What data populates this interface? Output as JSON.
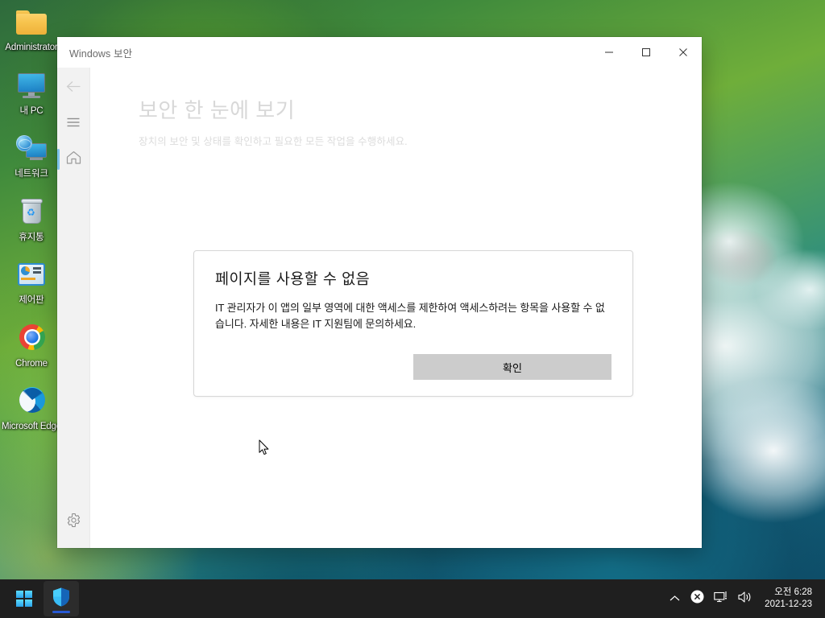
{
  "desktop": {
    "icons": [
      {
        "label": "Administrator",
        "icon": "folder-icon"
      },
      {
        "label": "내 PC",
        "icon": "computer-icon"
      },
      {
        "label": "네트워크",
        "icon": "network-icon"
      },
      {
        "label": "휴지통",
        "icon": "recycle-bin-icon"
      },
      {
        "label": "제어판",
        "icon": "control-panel-icon"
      },
      {
        "label": "Chrome",
        "icon": "chrome-icon"
      },
      {
        "label": "Microsoft Edge",
        "icon": "edge-icon"
      }
    ]
  },
  "window": {
    "title": "Windows 보안",
    "controls": {
      "minimize": "—",
      "maximize": "☐",
      "close": "✕"
    }
  },
  "nav": {
    "back": "뒤로",
    "menu": "메뉴",
    "home": "홈",
    "settings": "설정"
  },
  "page": {
    "title": "보안 한 눈에 보기",
    "subtitle": "장치의 보안 및 상태를 확인하고 필요한 모든 작업을 수행하세요."
  },
  "dialog": {
    "title": "페이지를 사용할 수 없음",
    "message": "IT 관리자가 이 앱의 일부 영역에 대한 액세스를 제한하여 액세스하려는 항목을 사용할 수 없습니다. 자세한 내용은 IT 지원팀에 문의하세요.",
    "ok_label": "확인",
    "button_color": "#cccccc"
  },
  "taskbar": {
    "start_label": "시작",
    "apps": [
      {
        "label": "Windows 보안",
        "icon": "shield-icon",
        "active": true
      }
    ],
    "tray": {
      "overflow": "숨겨진 아이콘 표시",
      "action_center": "알림",
      "network": "네트워크",
      "volume": "볼륨",
      "time": "오전 6:28",
      "date": "2021-12-23"
    }
  },
  "colors": {
    "accent": "#2759d4",
    "nav_selected": "#7fc3ee",
    "taskbar_bg": "#1f1f1f",
    "window_bg": "#ffffff"
  }
}
